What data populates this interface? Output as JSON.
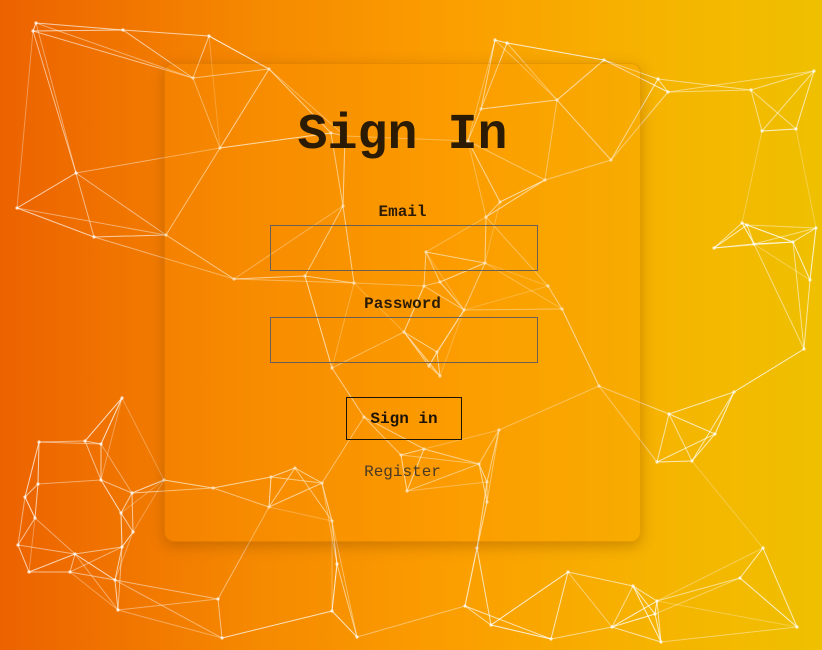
{
  "page": {
    "title": "Sign In"
  },
  "form": {
    "email_label": "Email",
    "email_value": "",
    "email_placeholder": "",
    "password_label": "Password",
    "password_value": "",
    "password_placeholder": "",
    "submit_label": "Sign in",
    "register_link": "Register"
  },
  "colors": {
    "gradient_start": "#ec6200",
    "gradient_end": "#efc000",
    "text": "#2b1b05"
  }
}
